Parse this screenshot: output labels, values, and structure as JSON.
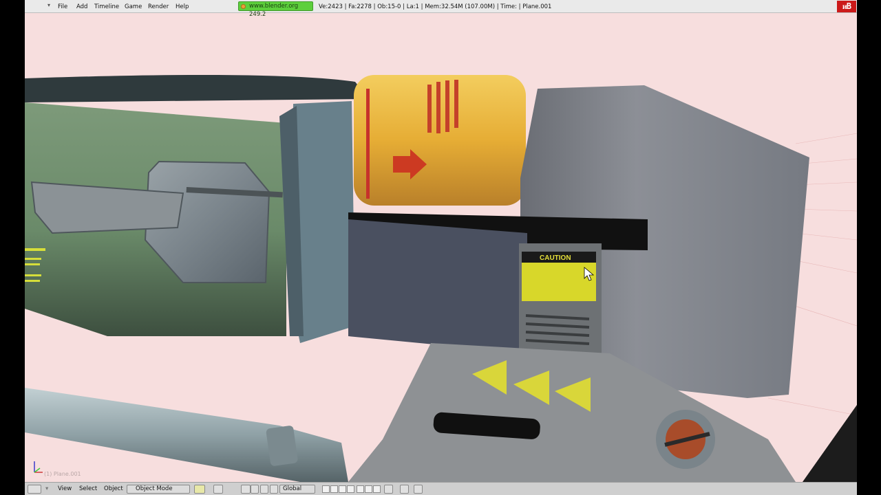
{
  "topbar": {
    "menu": [
      "File",
      "Add",
      "Timeline",
      "Game",
      "Render",
      "Help"
    ],
    "site_badge": "www.blender.org 249.2",
    "stats": "Ve:2423 | Fa:2278 | Ob:15-0 | La:1  | Mem:32.54M (107.00M)  | Time: | Plane.001",
    "logo": "ᴎB"
  },
  "viewport": {
    "caution_label": "CAUTION",
    "object_label": "(1) Plane.001"
  },
  "bottombar": {
    "view_label": "View",
    "select_label": "Select",
    "object_label": "Object",
    "mode_label": "Object Mode",
    "orientation_label": "Global"
  },
  "colors": {
    "background": "#f7dede",
    "badge": "#5dcf3c",
    "logo": "#cc1a1a",
    "canister": "#e9b43a"
  }
}
